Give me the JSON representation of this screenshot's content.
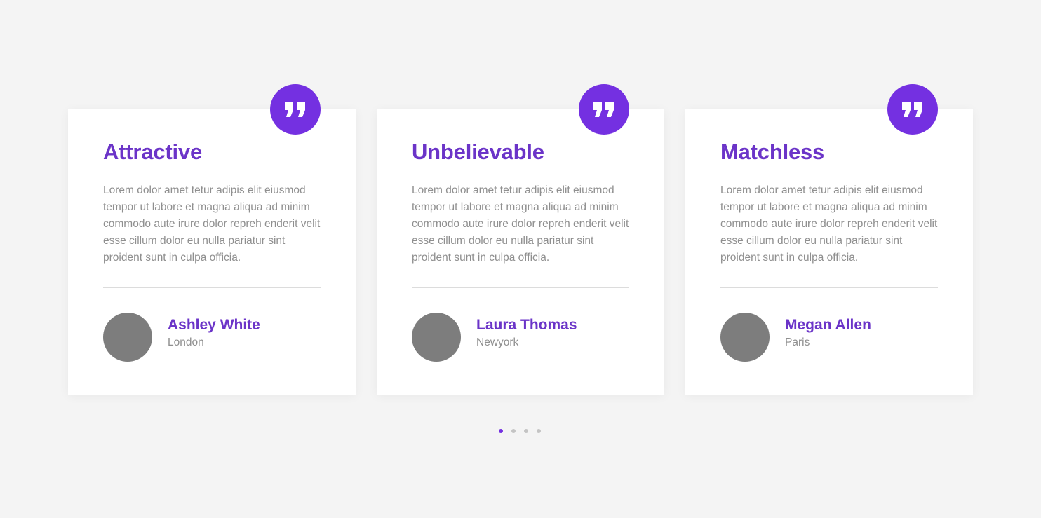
{
  "colors": {
    "accent": "#7430e1",
    "heading": "#6b34c8",
    "body_text": "#8f8f8f",
    "avatar_placeholder": "#7d7d7d",
    "background": "#f4f4f4",
    "card": "#ffffff"
  },
  "testimonials": [
    {
      "icon": "quote-icon",
      "title": "Attractive",
      "text": "Lorem dolor amet tetur adipis elit eiusmod tempor ut labore et magna aliqua ad minim commodo aute irure dolor repreh enderit velit esse cillum dolor eu nulla pariatur sint proident sunt in culpa officia.",
      "name": "Ashley White",
      "city": "London"
    },
    {
      "icon": "quote-icon",
      "title": "Unbelievable",
      "text": "Lorem dolor amet tetur adipis elit eiusmod tempor ut labore et magna aliqua ad minim commodo aute irure dolor repreh enderit velit esse cillum dolor eu nulla pariatur sint proident sunt in culpa officia.",
      "name": "Laura Thomas",
      "city": "Newyork"
    },
    {
      "icon": "quote-icon",
      "title": "Matchless",
      "text": "Lorem dolor amet tetur adipis elit eiusmod tempor ut labore et magna aliqua ad minim commodo aute irure dolor repreh enderit velit esse cillum dolor eu nulla pariatur sint proident sunt in culpa officia.",
      "name": "Megan Allen",
      "city": "Paris"
    }
  ],
  "pagination": {
    "active_index": 0,
    "dots": [
      1,
      2,
      3,
      4
    ]
  }
}
